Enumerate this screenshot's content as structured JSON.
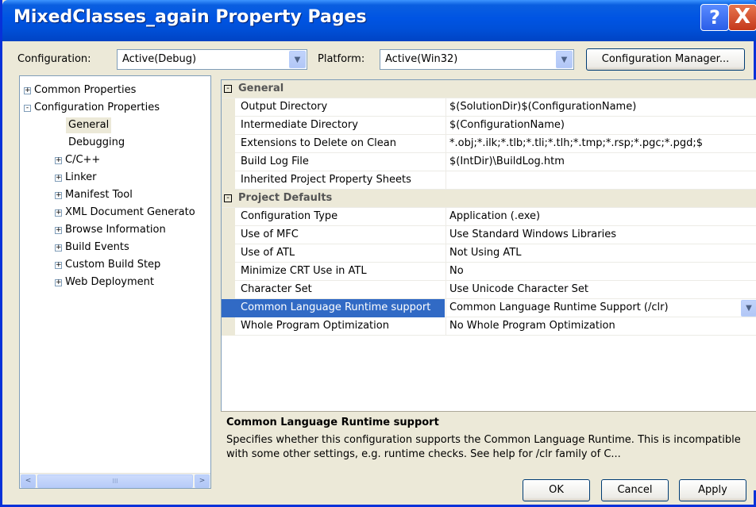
{
  "window": {
    "title": "MixedClasses_again Property Pages",
    "help_glyph": "?",
    "close_glyph": "X"
  },
  "toolbar": {
    "configuration_label": "Configuration:",
    "configuration_value": "Active(Debug)",
    "platform_label": "Platform:",
    "platform_value": "Active(Win32)",
    "config_manager_label": "Configuration Manager..."
  },
  "tree": {
    "items": [
      {
        "label": "Common Properties",
        "expander": "+"
      },
      {
        "label": "Configuration Properties",
        "expander": "-"
      },
      {
        "label": "General",
        "selected": true
      },
      {
        "label": "Debugging"
      },
      {
        "label": "C/C++",
        "expander": "+"
      },
      {
        "label": "Linker",
        "expander": "+"
      },
      {
        "label": "Manifest Tool",
        "expander": "+"
      },
      {
        "label": "XML Document Generato",
        "expander": "+"
      },
      {
        "label": "Browse Information",
        "expander": "+"
      },
      {
        "label": "Build Events",
        "expander": "+"
      },
      {
        "label": "Custom Build Step",
        "expander": "+"
      },
      {
        "label": "Web Deployment",
        "expander": "+"
      }
    ],
    "scroll_left_glyph": "<",
    "scroll_right_glyph": ">",
    "scroll_thumb_grip": "III"
  },
  "grid": {
    "categories": [
      {
        "title": "General",
        "expander": "-",
        "properties": [
          {
            "name": "Output Directory",
            "value": "$(SolutionDir)$(ConfigurationName)"
          },
          {
            "name": "Intermediate Directory",
            "value": "$(ConfigurationName)"
          },
          {
            "name": "Extensions to Delete on Clean",
            "value": "*.obj;*.ilk;*.tlb;*.tli;*.tlh;*.tmp;*.rsp;*.pgc;*.pgd;$"
          },
          {
            "name": "Build Log File",
            "value": "$(IntDir)\\BuildLog.htm"
          },
          {
            "name": "Inherited Project Property Sheets",
            "value": ""
          }
        ]
      },
      {
        "title": "Project Defaults",
        "expander": "-",
        "properties": [
          {
            "name": "Configuration Type",
            "value": "Application (.exe)"
          },
          {
            "name": "Use of MFC",
            "value": "Use Standard Windows Libraries"
          },
          {
            "name": "Use of ATL",
            "value": "Not Using ATL"
          },
          {
            "name": "Minimize CRT Use in ATL",
            "value": "No"
          },
          {
            "name": "Character Set",
            "value": "Use Unicode Character Set"
          },
          {
            "name": "Common Language Runtime support",
            "value": "Common Language Runtime Support (/clr)",
            "selected": true
          },
          {
            "name": "Whole Program Optimization",
            "value": "No Whole Program Optimization"
          }
        ]
      }
    ]
  },
  "description": {
    "title": "Common Language Runtime support",
    "text": "Specifies whether this configuration supports the Common Language Runtime.  This is incompatible with some other settings, e.g. runtime checks. See help for /clr family of C..."
  },
  "buttons": {
    "ok": "OK",
    "cancel": "Cancel",
    "apply": "Apply"
  },
  "colors": {
    "titlebar": "#0054e3",
    "selection": "#316ac5",
    "dialog_bg": "#ece9d8"
  }
}
